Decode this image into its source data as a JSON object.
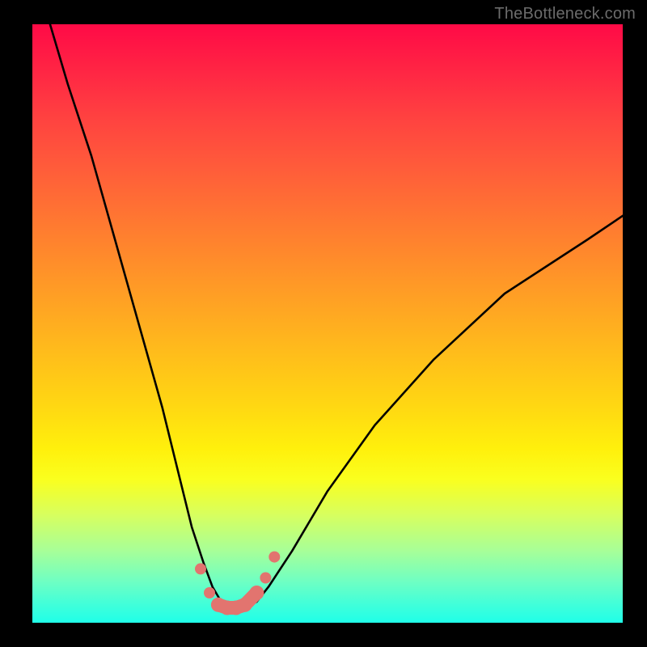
{
  "attribution": "TheBottleneck.com",
  "chart_data": {
    "type": "line",
    "title": "",
    "xlabel": "",
    "ylabel": "",
    "xlim": [
      0,
      100
    ],
    "ylim": [
      0,
      100
    ],
    "series": [
      {
        "name": "bottleneck-curve",
        "x": [
          3,
          6,
          10,
          14,
          18,
          22,
          25,
          27,
          29,
          30.5,
          32,
          34,
          36,
          38,
          40,
          44,
          50,
          58,
          68,
          80,
          94,
          100
        ],
        "y": [
          100,
          90,
          78,
          64,
          50,
          36,
          24,
          16,
          10,
          6,
          3.5,
          2.5,
          2.5,
          3.5,
          6,
          12,
          22,
          33,
          44,
          55,
          64,
          68
        ],
        "note": "y is bottleneck% (distance from optimum); curve minimum ≈ x 33–35"
      },
      {
        "name": "sample-markers",
        "type": "scatter",
        "x": [
          28.5,
          30,
          31.5,
          33,
          34.5,
          36,
          38,
          39.5,
          41
        ],
        "y": [
          9,
          5,
          3,
          2.5,
          2.5,
          3,
          5,
          7.5,
          11
        ],
        "color": "#e2746f"
      }
    ],
    "background_gradient": {
      "top": "#ff0a46",
      "mid": "#ffd812",
      "bottom": "#20ffe8"
    }
  }
}
